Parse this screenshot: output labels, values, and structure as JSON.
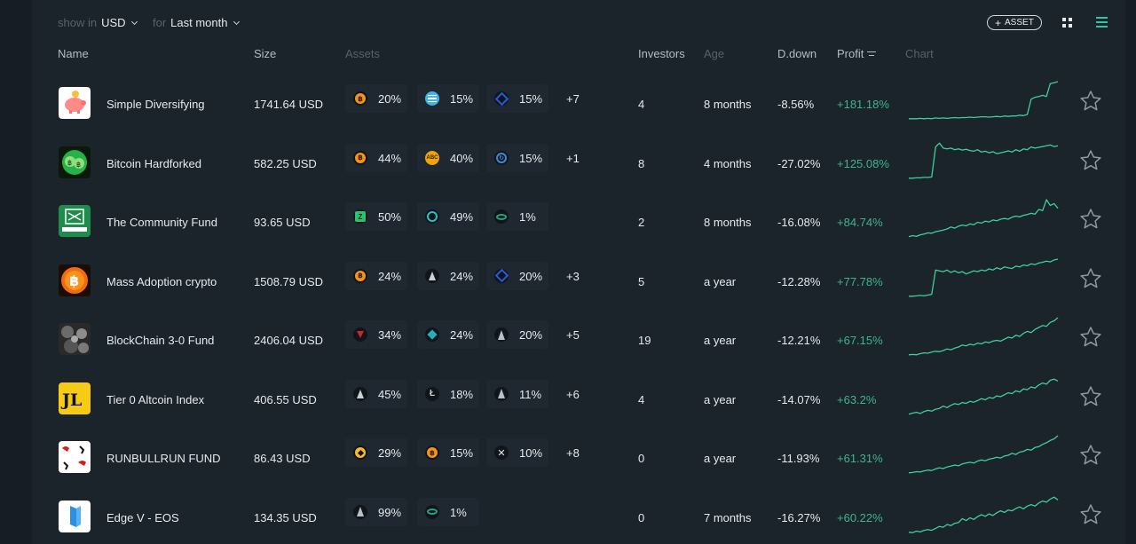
{
  "toolbar": {
    "show_in_label": "show in",
    "currency": "USD",
    "for_label": "for",
    "period": "Last month",
    "asset_button": "ASSET"
  },
  "columns": {
    "name": "Name",
    "size": "Size",
    "assets": "Assets",
    "investors": "Investors",
    "age": "Age",
    "ddown": "D.down",
    "profit": "Profit",
    "chart": "Chart"
  },
  "colors": {
    "accent": "#35c1a5",
    "profit_positive": "#3fb58f",
    "sparkline": "#3fcf9c"
  },
  "portfolios": [
    {
      "logo": "piggy-bank-logo",
      "name": "Simple Diversifying",
      "size": "1741.64 USD",
      "assets": [
        {
          "icon": "bitcoin-coin-icon",
          "pct": "20%"
        },
        {
          "icon": "stellar-coin-icon",
          "pct": "15%"
        },
        {
          "icon": "chainlink-coin-icon",
          "pct": "15%"
        }
      ],
      "more": "+7",
      "investors": "4",
      "age": "8 months",
      "ddown": "-8.56%",
      "profit": "+181.18%",
      "spark": [
        0.05,
        0.05,
        0.05,
        0.06,
        0.05,
        0.06,
        0.05,
        0.07,
        0.06,
        0.07,
        0.06,
        0.07,
        0.08,
        0.07,
        0.08,
        0.08,
        0.09,
        0.08,
        0.09,
        0.1,
        0.1,
        0.09,
        0.1,
        0.11,
        0.1,
        0.12,
        0.11,
        0.12,
        0.12,
        0.14,
        0.13,
        0.16,
        0.55,
        0.6,
        0.62,
        0.65,
        0.62,
        0.95,
        0.97,
        1.0
      ]
    },
    {
      "logo": "bitcoin-hardfork-logo",
      "name": "Bitcoin Hardforked",
      "size": "582.25 USD",
      "assets": [
        {
          "icon": "bitcoin-coin-icon",
          "pct": "44%"
        },
        {
          "icon": "bitcoin-abc-coin-icon",
          "pct": "40%"
        },
        {
          "icon": "bytecoin-coin-icon",
          "pct": "15%"
        }
      ],
      "more": "+1",
      "investors": "8",
      "age": "4 months",
      "ddown": "-27.02%",
      "profit": "+125.08%",
      "spark": [
        0.05,
        0.05,
        0.06,
        0.06,
        0.07,
        0.07,
        0.08,
        0.85,
        0.95,
        0.82,
        0.8,
        0.82,
        0.78,
        0.8,
        0.77,
        0.79,
        0.76,
        0.74,
        0.78,
        0.72,
        0.74,
        0.7,
        0.73,
        0.68,
        0.7,
        0.72,
        0.75,
        0.72,
        0.78,
        0.74,
        0.8,
        0.78,
        0.85,
        0.82,
        0.84,
        0.86,
        0.88,
        0.9,
        0.86,
        0.88
      ]
    },
    {
      "logo": "kiwisaver-logo",
      "name": "The Community Fund",
      "size": "93.65 USD",
      "assets": [
        {
          "icon": "zcoin-coin-icon",
          "pct": "50%"
        },
        {
          "icon": "icon-coin-icon",
          "pct": "49%"
        },
        {
          "icon": "tether-coin-icon",
          "pct": "1%"
        }
      ],
      "more": "",
      "investors": "2",
      "age": "8 months",
      "ddown": "-16.08%",
      "profit": "+84.74%",
      "spark": [
        0.05,
        0.08,
        0.06,
        0.1,
        0.12,
        0.15,
        0.14,
        0.18,
        0.2,
        0.22,
        0.25,
        0.3,
        0.27,
        0.32,
        0.35,
        0.33,
        0.38,
        0.36,
        0.42,
        0.4,
        0.45,
        0.43,
        0.48,
        0.46,
        0.5,
        0.52,
        0.5,
        0.55,
        0.58,
        0.56,
        0.6,
        0.62,
        0.65,
        0.63,
        0.75,
        0.72,
        1.0,
        0.85,
        0.9,
        0.78
      ]
    },
    {
      "logo": "bitcoin-orange-logo",
      "name": "Mass Adoption crypto",
      "size": "1508.79 USD",
      "assets": [
        {
          "icon": "bitcoin-coin-icon",
          "pct": "24%"
        },
        {
          "icon": "ethereum-coin-icon",
          "pct": "24%"
        },
        {
          "icon": "chainlink-coin-icon",
          "pct": "20%"
        }
      ],
      "more": "+3",
      "investors": "5",
      "age": "a year",
      "ddown": "-12.28%",
      "profit": "+77.78%",
      "spark": [
        0.05,
        0.05,
        0.06,
        0.07,
        0.06,
        0.08,
        0.1,
        0.72,
        0.7,
        0.68,
        0.72,
        0.66,
        0.7,
        0.65,
        0.68,
        0.62,
        0.66,
        0.7,
        0.68,
        0.72,
        0.7,
        0.75,
        0.72,
        0.78,
        0.74,
        0.8,
        0.78,
        0.76,
        0.82,
        0.8,
        0.85,
        0.83,
        0.88,
        0.86,
        0.9,
        0.92,
        0.95,
        0.93,
        0.98,
        1.0
      ]
    },
    {
      "logo": "blockchain-fund-logo",
      "name": "BlockChain 3-0 Fund",
      "size": "2406.04 USD",
      "assets": [
        {
          "icon": "ark-coin-icon",
          "pct": "34%"
        },
        {
          "icon": "waves-coin-icon",
          "pct": "24%"
        },
        {
          "icon": "eos-coin-icon",
          "pct": "20%"
        }
      ],
      "more": "+5",
      "investors": "19",
      "age": "a year",
      "ddown": "-12.21%",
      "profit": "+67.15%",
      "spark": [
        0.05,
        0.06,
        0.05,
        0.08,
        0.1,
        0.09,
        0.12,
        0.14,
        0.13,
        0.16,
        0.2,
        0.18,
        0.22,
        0.25,
        0.3,
        0.28,
        0.32,
        0.3,
        0.35,
        0.33,
        0.38,
        0.36,
        0.4,
        0.42,
        0.4,
        0.45,
        0.5,
        0.48,
        0.55,
        0.52,
        0.6,
        0.65,
        0.62,
        0.7,
        0.75,
        0.8,
        0.78,
        0.88,
        0.92,
        1.0
      ]
    },
    {
      "logo": "jl-logo",
      "name": "Tier 0 Altcoin Index",
      "size": "406.55 USD",
      "assets": [
        {
          "icon": "ethereum-coin-icon",
          "pct": "45%"
        },
        {
          "icon": "litecoin-coin-icon",
          "pct": "18%"
        },
        {
          "icon": "eos-coin-icon",
          "pct": "11%"
        }
      ],
      "more": "+6",
      "investors": "4",
      "age": "a year",
      "ddown": "-14.07%",
      "profit": "+63.2%",
      "spark": [
        0.05,
        0.08,
        0.1,
        0.07,
        0.12,
        0.15,
        0.13,
        0.18,
        0.2,
        0.26,
        0.22,
        0.28,
        0.32,
        0.3,
        0.35,
        0.33,
        0.38,
        0.36,
        0.4,
        0.45,
        0.42,
        0.48,
        0.46,
        0.52,
        0.5,
        0.55,
        0.6,
        0.58,
        0.65,
        0.62,
        0.7,
        0.68,
        0.75,
        0.72,
        0.8,
        0.85,
        0.82,
        0.92,
        0.95,
        0.9
      ]
    },
    {
      "logo": "runbullrun-logo",
      "name": "RUNBULLRUN FUND",
      "size": "86.43 USD",
      "assets": [
        {
          "icon": "binance-coin-icon",
          "pct": "29%"
        },
        {
          "icon": "bitcoin-coin-icon",
          "pct": "15%"
        },
        {
          "icon": "xrp-coin-icon",
          "pct": "10%"
        }
      ],
      "more": "+8",
      "investors": "0",
      "age": "a year",
      "ddown": "-11.93%",
      "profit": "+61.31%",
      "spark": [
        0.05,
        0.06,
        0.08,
        0.07,
        0.1,
        0.12,
        0.11,
        0.15,
        0.18,
        0.16,
        0.2,
        0.22,
        0.25,
        0.23,
        0.28,
        0.3,
        0.32,
        0.3,
        0.35,
        0.38,
        0.36,
        0.4,
        0.42,
        0.45,
        0.43,
        0.48,
        0.5,
        0.55,
        0.52,
        0.58,
        0.6,
        0.65,
        0.63,
        0.7,
        0.72,
        0.78,
        0.82,
        0.88,
        0.92,
        1.0
      ]
    },
    {
      "logo": "edge-v-logo",
      "name": "Edge V - EOS",
      "size": "134.35 USD",
      "assets": [
        {
          "icon": "eos-coin-icon",
          "pct": "99%"
        },
        {
          "icon": "tether-coin-icon",
          "pct": "1%"
        }
      ],
      "more": "",
      "investors": "0",
      "age": "7 months",
      "ddown": "-16.27%",
      "profit": "+60.22%",
      "spark": [
        0.05,
        0.04,
        0.08,
        0.06,
        0.1,
        0.12,
        0.1,
        0.15,
        0.2,
        0.18,
        0.25,
        0.22,
        0.28,
        0.3,
        0.4,
        0.35,
        0.42,
        0.38,
        0.45,
        0.5,
        0.46,
        0.52,
        0.48,
        0.55,
        0.6,
        0.56,
        0.62,
        0.6,
        0.66,
        0.7,
        0.65,
        0.72,
        0.76,
        0.72,
        0.8,
        0.85,
        0.82,
        0.9,
        0.95,
        0.88
      ]
    }
  ]
}
